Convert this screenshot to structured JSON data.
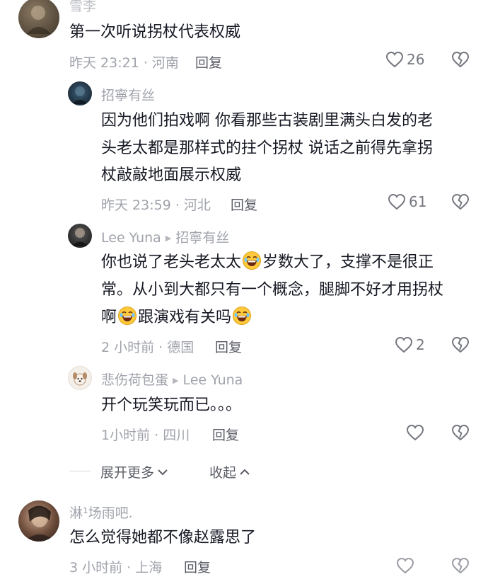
{
  "comments": [
    {
      "id": "c1",
      "username": "雪李",
      "text": "第一次听说拐杖代表权威",
      "meta": "昨天 23:21 · 河南",
      "reply": "回复",
      "likes": "26"
    },
    {
      "id": "c2",
      "username": "招寧有丝",
      "text_lines": [
        "因为他们拍戏啊 你看那些古装剧里满头白发的老",
        "头老太都是那样式的拄个拐杖 说话之前得先拿拐",
        "杖敲敲地面展示权威"
      ],
      "meta": "昨天 23:59 · 河北",
      "reply": "回复",
      "likes": "61"
    },
    {
      "id": "c3",
      "username": "Lee Yuna",
      "reply_to": "招寧有丝",
      "line1_a": "你也说了老头老太太",
      "line1_b": "岁数大了，支撑不是很正",
      "line2": "常。从小到大都只有一个概念，腿脚不好才用拐杖",
      "line3_a": "啊",
      "line3_b": "跟演戏有关吗",
      "meta": "2 小时前 · 德国",
      "reply": "回复",
      "likes": "2"
    },
    {
      "id": "c4",
      "username": "悲伤荷包蛋",
      "reply_to": "Lee Yuna",
      "text": "开个玩笑玩而已。。。",
      "meta": "1小时前 · 四川",
      "reply": "回复",
      "likes": ""
    },
    {
      "id": "c5",
      "username": "淋¹场雨吧.",
      "text": "怎么觉得她都不像赵露思了",
      "meta": "3 小时前 · 上海",
      "reply": "回复",
      "likes": ""
    }
  ],
  "thread_controls": {
    "expand_more": "展开更多",
    "collapse": "收起"
  },
  "colors": {
    "text": "#161823",
    "meta": "#a0a3ab",
    "reply": "#5b5d66",
    "icon": "#75777f"
  }
}
